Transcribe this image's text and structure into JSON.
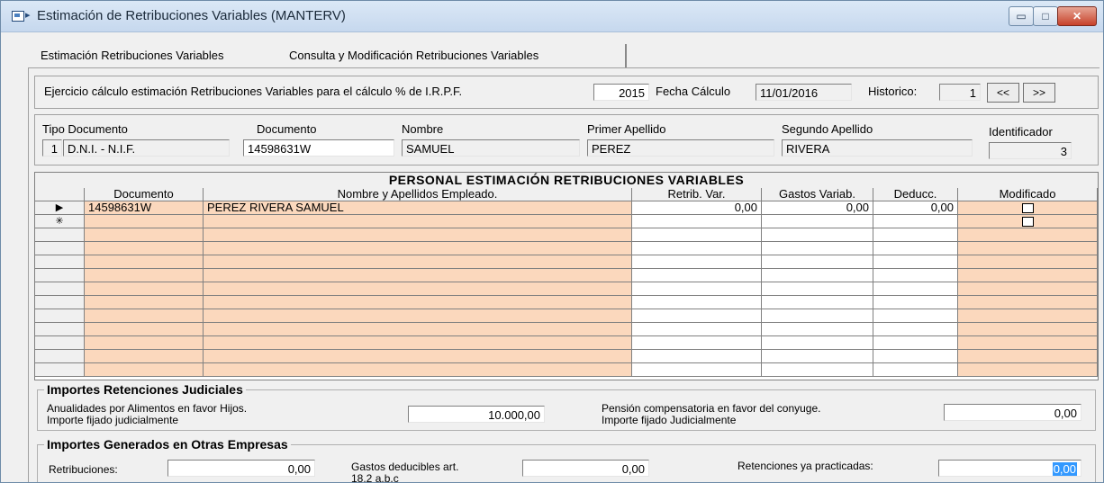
{
  "window": {
    "title": "Estimación de Retribuciones Variables  (MANTERV)",
    "min_icon": "minimize-icon",
    "max_icon": "maximize-icon",
    "close_icon": "close-icon",
    "min_glyph": "▭",
    "max_glyph": "□",
    "close_glyph": "✕"
  },
  "tabs": [
    {
      "label": "Estimación Retribuciones Variables"
    },
    {
      "label": "Consulta y  Modificación Retribuciones Variables"
    }
  ],
  "header": {
    "ejercicio_label": "Ejercicio cálculo estimación Retribuciones Variables para el cálculo % de I.R.P.F.",
    "ejercicio_value": "2015",
    "fecha_label": "Fecha Cálculo",
    "fecha_value": "11/01/2016",
    "historico_label": "Historico:",
    "historico_value": "1",
    "prev_label": "<<",
    "next_label": ">>"
  },
  "person": {
    "tipo_doc_label": "Tipo Documento",
    "tipo_doc_code": "1",
    "tipo_doc_value": "D.N.I. - N.I.F.",
    "documento_label": "Documento",
    "documento_value": "14598631W",
    "nombre_label": "Nombre",
    "nombre_value": "SAMUEL",
    "apellido1_label": "Primer Apellido",
    "apellido1_value": "PEREZ",
    "apellido2_label": "Segundo Apellido",
    "apellido2_value": "RIVERA",
    "identificador_label": "Identificador",
    "identificador_value": "3"
  },
  "grid": {
    "title": "PERSONAL ESTIMACIÓN RETRIBUCIONES VARIABLES",
    "columns": [
      "Documento",
      "Nombre y Apellidos Empleado.",
      "Retrib. Var.",
      "Gastos Variab.",
      "Deducc.",
      "Modificado"
    ],
    "current_row_marker": "▶",
    "new_row_marker": "✳",
    "rows": [
      {
        "documento": "14598631W",
        "nombre": "PEREZ RIVERA SAMUEL",
        "retrib": "0,00",
        "gastos": "0,00",
        "deducc": "0,00"
      }
    ]
  },
  "judiciales": {
    "title": "Importes Retenciones Judiciales",
    "anualidades_label_1": "Anualidades por Alimentos en favor Hijos.",
    "anualidades_label_2": "Importe fijado judicialmente",
    "anualidades_value": "10.000,00",
    "pension_label_1": "Pensión compensatoria en favor del conyuge.",
    "pension_label_2": "Importe fijado Judicialmente",
    "pension_value": "0,00"
  },
  "otras": {
    "title": "Importes Generados en Otras Empresas",
    "retribuciones_label": "Retribuciones:",
    "retribuciones_value": "0,00",
    "gastos_label_1": "Gastos deducibles  art.",
    "gastos_label_2": "18.2 a.b.c",
    "gastos_value": "0,00",
    "retenciones_label": "Retenciones ya practicadas:",
    "retenciones_value": "0,00"
  }
}
